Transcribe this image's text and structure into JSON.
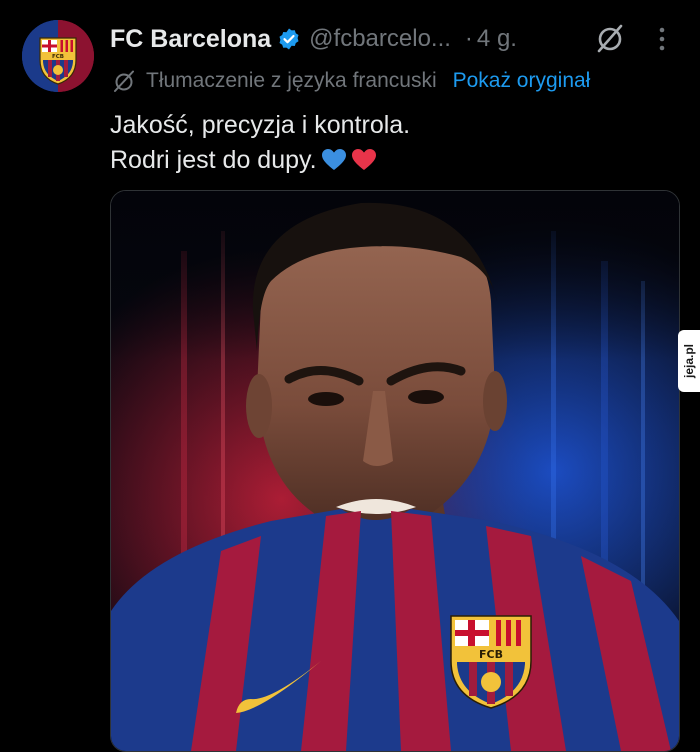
{
  "tweet": {
    "author_name": "FC Barcelona",
    "handle": "@fcbarcelo...",
    "separator": "·",
    "time": "4 g.",
    "translation_label": "Tłumaczenie z języka francuski",
    "show_original_label": "Pokaż oryginał",
    "text_line_1": "Jakość, precyzja i kontrola.",
    "text_line_2": "Rodri jest do dupy."
  },
  "crest": {
    "letters": "FCB"
  },
  "watermark": {
    "text": "jeja.pl"
  },
  "icons": {
    "verified": "verified-badge-icon",
    "grok": "grok-icon",
    "more": "more-vertical-icon",
    "translate": "translate-icon",
    "blue_heart": "blue-heart-emoji",
    "red_heart": "red-heart-emoji"
  },
  "colors": {
    "background": "#000000",
    "text_primary": "#e7e9ea",
    "text_secondary": "#71767b",
    "link": "#1d9bf0",
    "verified": "#1d9bf0",
    "barca_blue": "#1b3a8a",
    "barca_red": "#a01c3e"
  }
}
